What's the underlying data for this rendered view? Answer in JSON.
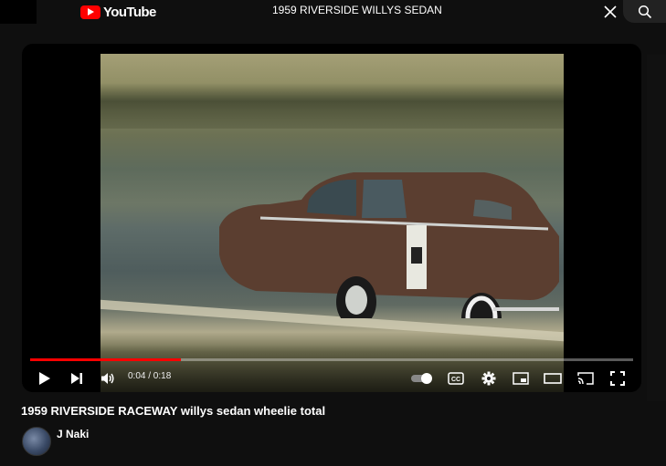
{
  "header": {
    "logo_text": "YouTube",
    "search_query": "1959 RIVERSIDE WILLYS SEDAN"
  },
  "player": {
    "progress_fraction": 0.25,
    "time_display": "0:04 / 0:18",
    "controls": [
      "play-icon",
      "next-icon",
      "volume-icon",
      "autoplay-toggle",
      "subtitles-icon",
      "settings-icon",
      "miniplayer-icon",
      "theater-icon",
      "cast-icon",
      "fullscreen-icon"
    ],
    "subtitles_label": "CC"
  },
  "video": {
    "title": "1959 RIVERSIDE RACEWAY willys sedan wheelie total"
  },
  "channel": {
    "name": "J Naki"
  },
  "colors": {
    "accent": "#ff0000",
    "background": "#0f0f0f"
  }
}
